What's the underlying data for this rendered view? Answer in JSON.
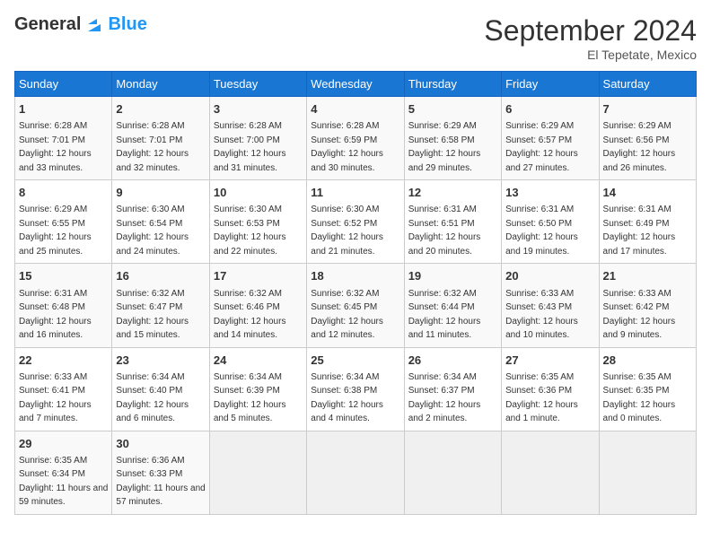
{
  "header": {
    "logo_general": "General",
    "logo_blue": "Blue",
    "month_title": "September 2024",
    "location": "El Tepetate, Mexico"
  },
  "columns": [
    "Sunday",
    "Monday",
    "Tuesday",
    "Wednesday",
    "Thursday",
    "Friday",
    "Saturday"
  ],
  "weeks": [
    [
      {
        "day": "1",
        "sunrise": "6:28 AM",
        "sunset": "7:01 PM",
        "daylight": "12 hours and 33 minutes."
      },
      {
        "day": "2",
        "sunrise": "6:28 AM",
        "sunset": "7:01 PM",
        "daylight": "12 hours and 32 minutes."
      },
      {
        "day": "3",
        "sunrise": "6:28 AM",
        "sunset": "7:00 PM",
        "daylight": "12 hours and 31 minutes."
      },
      {
        "day": "4",
        "sunrise": "6:28 AM",
        "sunset": "6:59 PM",
        "daylight": "12 hours and 30 minutes."
      },
      {
        "day": "5",
        "sunrise": "6:29 AM",
        "sunset": "6:58 PM",
        "daylight": "12 hours and 29 minutes."
      },
      {
        "day": "6",
        "sunrise": "6:29 AM",
        "sunset": "6:57 PM",
        "daylight": "12 hours and 27 minutes."
      },
      {
        "day": "7",
        "sunrise": "6:29 AM",
        "sunset": "6:56 PM",
        "daylight": "12 hours and 26 minutes."
      }
    ],
    [
      {
        "day": "8",
        "sunrise": "6:29 AM",
        "sunset": "6:55 PM",
        "daylight": "12 hours and 25 minutes."
      },
      {
        "day": "9",
        "sunrise": "6:30 AM",
        "sunset": "6:54 PM",
        "daylight": "12 hours and 24 minutes."
      },
      {
        "day": "10",
        "sunrise": "6:30 AM",
        "sunset": "6:53 PM",
        "daylight": "12 hours and 22 minutes."
      },
      {
        "day": "11",
        "sunrise": "6:30 AM",
        "sunset": "6:52 PM",
        "daylight": "12 hours and 21 minutes."
      },
      {
        "day": "12",
        "sunrise": "6:31 AM",
        "sunset": "6:51 PM",
        "daylight": "12 hours and 20 minutes."
      },
      {
        "day": "13",
        "sunrise": "6:31 AM",
        "sunset": "6:50 PM",
        "daylight": "12 hours and 19 minutes."
      },
      {
        "day": "14",
        "sunrise": "6:31 AM",
        "sunset": "6:49 PM",
        "daylight": "12 hours and 17 minutes."
      }
    ],
    [
      {
        "day": "15",
        "sunrise": "6:31 AM",
        "sunset": "6:48 PM",
        "daylight": "12 hours and 16 minutes."
      },
      {
        "day": "16",
        "sunrise": "6:32 AM",
        "sunset": "6:47 PM",
        "daylight": "12 hours and 15 minutes."
      },
      {
        "day": "17",
        "sunrise": "6:32 AM",
        "sunset": "6:46 PM",
        "daylight": "12 hours and 14 minutes."
      },
      {
        "day": "18",
        "sunrise": "6:32 AM",
        "sunset": "6:45 PM",
        "daylight": "12 hours and 12 minutes."
      },
      {
        "day": "19",
        "sunrise": "6:32 AM",
        "sunset": "6:44 PM",
        "daylight": "12 hours and 11 minutes."
      },
      {
        "day": "20",
        "sunrise": "6:33 AM",
        "sunset": "6:43 PM",
        "daylight": "12 hours and 10 minutes."
      },
      {
        "day": "21",
        "sunrise": "6:33 AM",
        "sunset": "6:42 PM",
        "daylight": "12 hours and 9 minutes."
      }
    ],
    [
      {
        "day": "22",
        "sunrise": "6:33 AM",
        "sunset": "6:41 PM",
        "daylight": "12 hours and 7 minutes."
      },
      {
        "day": "23",
        "sunrise": "6:34 AM",
        "sunset": "6:40 PM",
        "daylight": "12 hours and 6 minutes."
      },
      {
        "day": "24",
        "sunrise": "6:34 AM",
        "sunset": "6:39 PM",
        "daylight": "12 hours and 5 minutes."
      },
      {
        "day": "25",
        "sunrise": "6:34 AM",
        "sunset": "6:38 PM",
        "daylight": "12 hours and 4 minutes."
      },
      {
        "day": "26",
        "sunrise": "6:34 AM",
        "sunset": "6:37 PM",
        "daylight": "12 hours and 2 minutes."
      },
      {
        "day": "27",
        "sunrise": "6:35 AM",
        "sunset": "6:36 PM",
        "daylight": "12 hours and 1 minute."
      },
      {
        "day": "28",
        "sunrise": "6:35 AM",
        "sunset": "6:35 PM",
        "daylight": "12 hours and 0 minutes."
      }
    ],
    [
      {
        "day": "29",
        "sunrise": "6:35 AM",
        "sunset": "6:34 PM",
        "daylight": "11 hours and 59 minutes."
      },
      {
        "day": "30",
        "sunrise": "6:36 AM",
        "sunset": "6:33 PM",
        "daylight": "11 hours and 57 minutes."
      },
      null,
      null,
      null,
      null,
      null
    ]
  ]
}
